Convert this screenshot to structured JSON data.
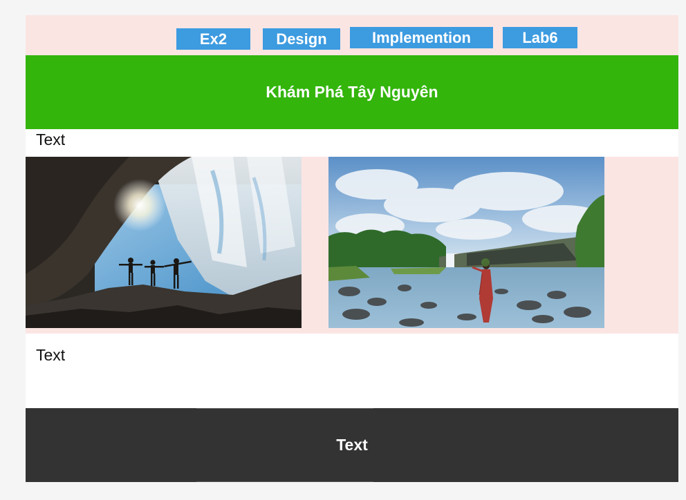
{
  "nav": {
    "items": [
      {
        "label": "Ex2"
      },
      {
        "label": "Design"
      },
      {
        "label": "Implemention"
      },
      {
        "label": "Lab6"
      }
    ],
    "bg_color": "#fbe5e3",
    "button_color": "#3d9be0"
  },
  "hero": {
    "title": "Khám Phá Tây Nguyên",
    "bg_color": "#33b50c"
  },
  "content": {
    "text_top": "Text",
    "text_bottom": "Text"
  },
  "gallery": {
    "images": [
      {
        "name": "waterfall-cave-photo"
      },
      {
        "name": "river-waterfall-photo"
      }
    ]
  },
  "footer": {
    "label": "Text",
    "bg_color": "#333333"
  }
}
